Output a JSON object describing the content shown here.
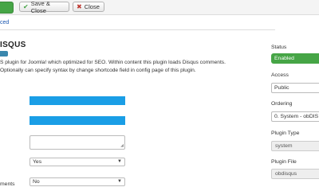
{
  "toolbar": {
    "save_close_label": "Save & Close",
    "close_label": "Close"
  },
  "tabs": {
    "advanced_fragment": "ced"
  },
  "plugin": {
    "title": "ISQUS",
    "description_lines": [
      "S plugin for Joomla! which optimized for SEO. Within content this plugin loads Disqus comments.",
      " Optionally can specify syntax by change shortcode field in config page of this plugin."
    ]
  },
  "form": {
    "select1_value": "Yes",
    "label_fragment": "ments",
    "select2_value": "No"
  },
  "sidebar": {
    "status_label": "Status",
    "status_value": "Enabled",
    "access_label": "Access",
    "access_value": "Public",
    "ordering_label": "Ordering",
    "ordering_value": "0. System - obDIS",
    "plugin_type_label": "Plugin Type",
    "plugin_type_value": "system",
    "plugin_file_label": "Plugin File",
    "plugin_file_value": "obdisqus"
  },
  "colors": {
    "success": "#46a546",
    "field_highlight": "#1a9ee6",
    "link": "#1b57b1"
  }
}
